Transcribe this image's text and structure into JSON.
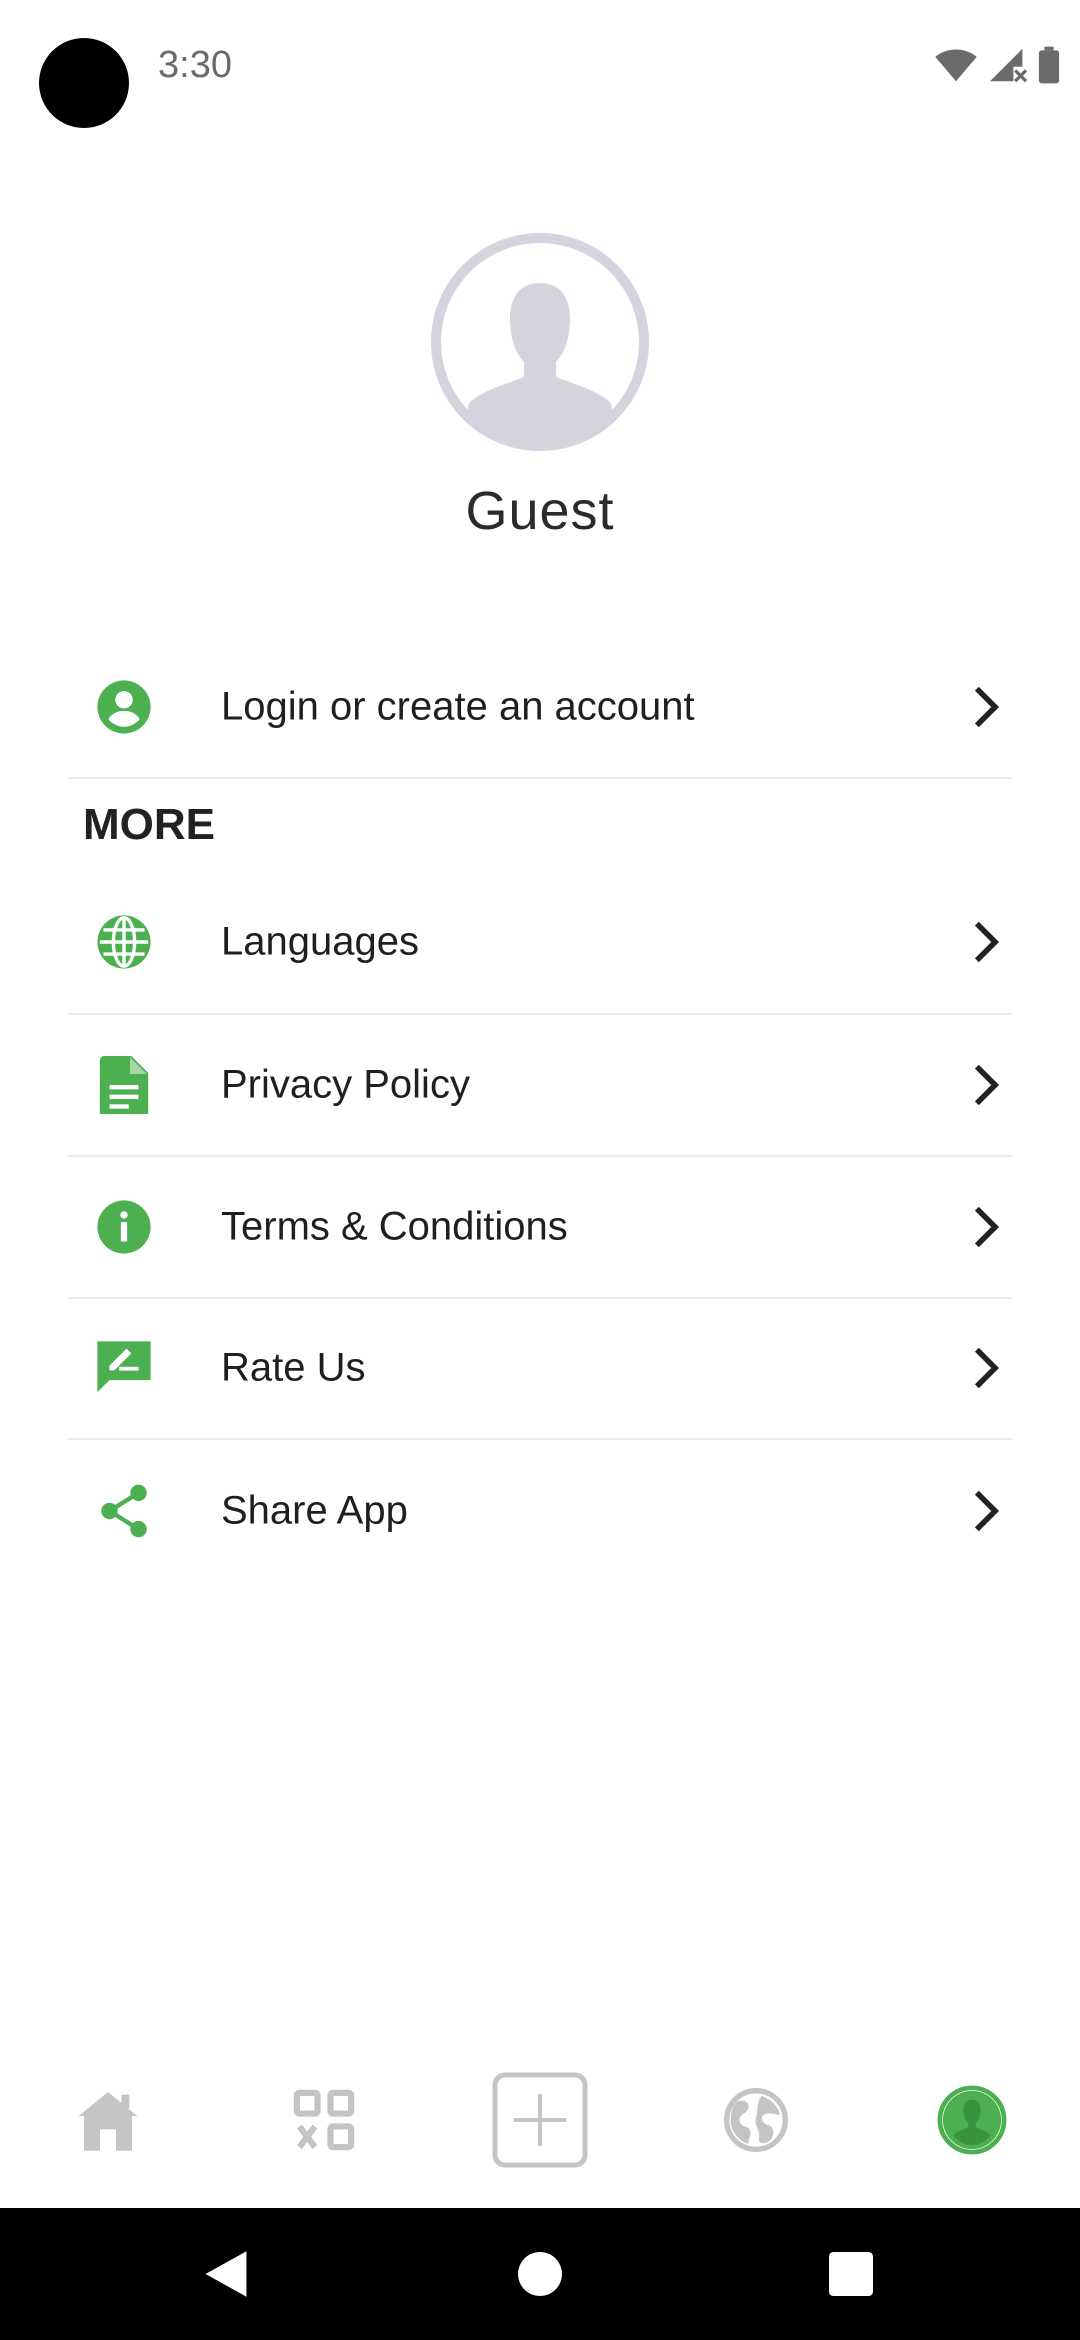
{
  "status_bar": {
    "time": "3:30"
  },
  "profile": {
    "name": "Guest"
  },
  "menu": {
    "login_label": "Login or create an account",
    "section_title": "MORE",
    "items": [
      {
        "label": "Languages",
        "icon": "globe-icon"
      },
      {
        "label": "Privacy Policy",
        "icon": "document-icon"
      },
      {
        "label": "Terms & Conditions",
        "icon": "info-icon"
      },
      {
        "label": "Rate Us",
        "icon": "rate-review-icon"
      },
      {
        "label": "Share App",
        "icon": "share-icon"
      }
    ]
  },
  "bottom_nav": {
    "items": [
      "home-icon",
      "apps-grid-icon",
      "add-icon",
      "globe-icon",
      "profile-icon"
    ],
    "active": "profile-icon"
  },
  "colors": {
    "accent": "#4caf50",
    "inactive": "#bdbdbd",
    "avatar": "#d4d4de"
  }
}
